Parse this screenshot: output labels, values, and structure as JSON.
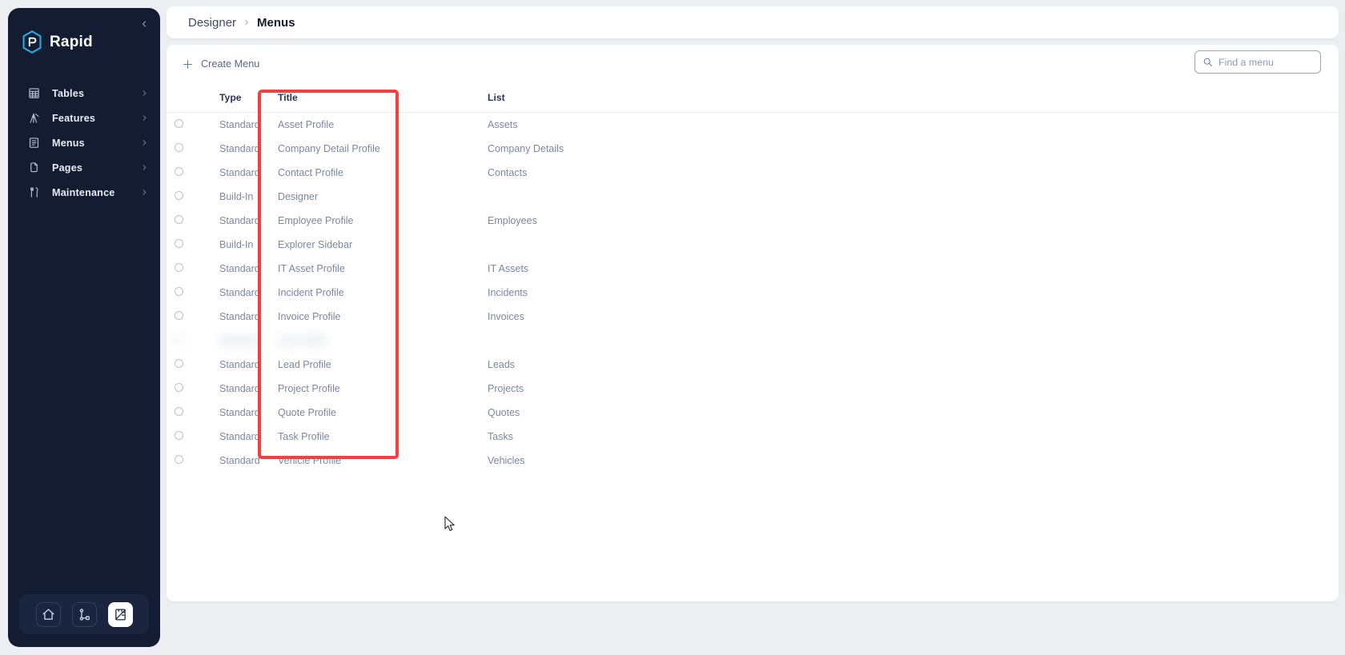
{
  "app": {
    "brand_name": "Rapid",
    "brand_logo_icon": "hexagon-r-logo"
  },
  "sidebar": {
    "collapse_icon": "chevron-left-icon",
    "items": [
      {
        "label": "Tables",
        "icon": "table-grid-icon",
        "chevron": "chevron-right-icon"
      },
      {
        "label": "Features",
        "icon": "crane-icon",
        "chevron": "chevron-right-icon"
      },
      {
        "label": "Menus",
        "icon": "list-doc-icon",
        "chevron": "chevron-right-icon"
      },
      {
        "label": "Pages",
        "icon": "pages-copy-icon",
        "chevron": "chevron-right-icon"
      },
      {
        "label": "Maintenance",
        "icon": "tools-icon",
        "chevron": "chevron-right-icon"
      }
    ],
    "dock": [
      {
        "name": "home-icon",
        "active": false
      },
      {
        "name": "workflow-icon",
        "active": false
      },
      {
        "name": "designer-icon",
        "active": true
      }
    ]
  },
  "breadcrumb": {
    "parent": "Designer",
    "separator_icon": "chevron-right-icon",
    "current": "Menus"
  },
  "toolbar": {
    "create_label": "Create Menu",
    "create_icon": "plus-icon"
  },
  "search": {
    "icon": "search-icon",
    "placeholder": "Find a menu",
    "value": ""
  },
  "table": {
    "columns": [
      "",
      "Type",
      "Title",
      "List"
    ],
    "rows": [
      {
        "type": "Standard",
        "title": "Asset Profile",
        "list": "Assets",
        "blurred": false
      },
      {
        "type": "Standard",
        "title": "Company Detail Profile",
        "list": "Company Details",
        "blurred": false
      },
      {
        "type": "Standard",
        "title": "Contact Profile",
        "list": "Contacts",
        "blurred": false
      },
      {
        "type": "Build-In",
        "title": "Designer",
        "list": "",
        "blurred": false
      },
      {
        "type": "Standard",
        "title": "Employee Profile",
        "list": "Employees",
        "blurred": false
      },
      {
        "type": "Build-In",
        "title": "Explorer Sidebar",
        "list": "",
        "blurred": false
      },
      {
        "type": "Standard",
        "title": "IT Asset Profile",
        "list": "IT Assets",
        "blurred": false
      },
      {
        "type": "Standard",
        "title": "Incident Profile",
        "list": "Incidents",
        "blurred": false
      },
      {
        "type": "Standard",
        "title": "Invoice Profile",
        "list": "Invoices",
        "blurred": false
      },
      {
        "type": "Standard",
        "title": "Lab Profile",
        "list": "",
        "blurred": true
      },
      {
        "type": "Standard",
        "title": "Lead Profile",
        "list": "Leads",
        "blurred": false
      },
      {
        "type": "Standard",
        "title": "Project Profile",
        "list": "Projects",
        "blurred": false
      },
      {
        "type": "Standard",
        "title": "Quote Profile",
        "list": "Quotes",
        "blurred": false
      },
      {
        "type": "Standard",
        "title": "Task Profile",
        "list": "Tasks",
        "blurred": false
      },
      {
        "type": "Standard",
        "title": "Vehicle Profile",
        "list": "Vehicles",
        "blurred": false
      }
    ]
  },
  "annotation": {
    "name": "title-column-highlight",
    "color": "#f0413e"
  },
  "colors": {
    "sidebar_bg": "#131c31",
    "page_bg": "#eceef1",
    "card_bg": "#ffffff",
    "accent_red": "#f0413e",
    "text_muted": "#7c87a0",
    "text_dark": "#111a2e"
  }
}
